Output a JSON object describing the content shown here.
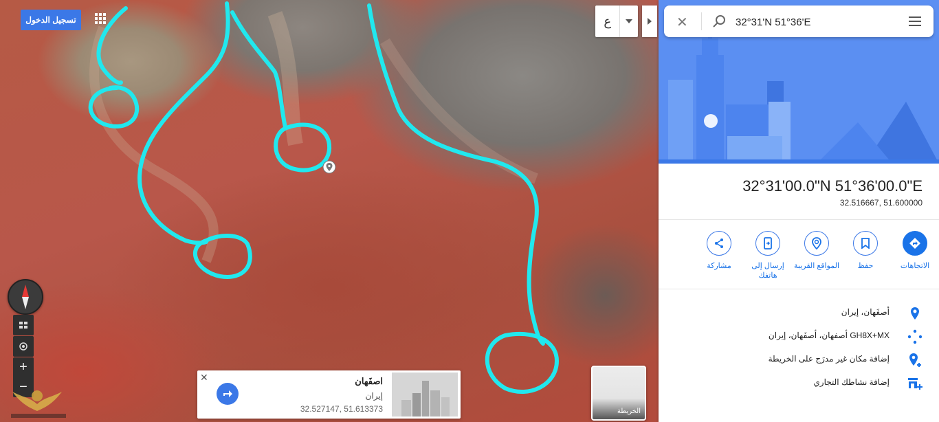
{
  "topbar": {
    "login_label": "تسجيل الدخول"
  },
  "language": {
    "letter": "ع"
  },
  "infocard": {
    "title": "اصفَهان",
    "subtitle": "إيران",
    "coords": "32.527147, 51.613373"
  },
  "layer": {
    "label": "الخريطة"
  },
  "search": {
    "value": "32°31'N 51°36'E"
  },
  "place": {
    "title": "32°31'00.0\"N 51°36'00.0\"E",
    "decimal": "32.516667, 51.600000"
  },
  "actions": [
    {
      "label": "الاتجاهات",
      "icon": "directions-icon"
    },
    {
      "label": "حفظ",
      "icon": "bookmark-icon"
    },
    {
      "label": "المواقع القريبة",
      "icon": "nearby-icon"
    },
    {
      "label": "إرسال إلى هاتفك",
      "icon": "send-to-phone-icon"
    },
    {
      "label": "مشاركة",
      "icon": "share-icon"
    }
  ],
  "details": [
    {
      "text": "أصفَهان، إيران",
      "icon": "location-pin-icon"
    },
    {
      "text": "GH8X+MX أصفهان، أصفَهان، إيران",
      "icon": "plus-code-icon"
    },
    {
      "text": "إضافة مكان غير مدرَج على الخريطة",
      "icon": "add-place-icon"
    },
    {
      "text": "إضافة نشاطك التجاري",
      "icon": "add-business-icon"
    }
  ],
  "colors": {
    "accent": "#1a73e8",
    "annotation": "#21e8ee",
    "hero": "#5b8ff2"
  }
}
